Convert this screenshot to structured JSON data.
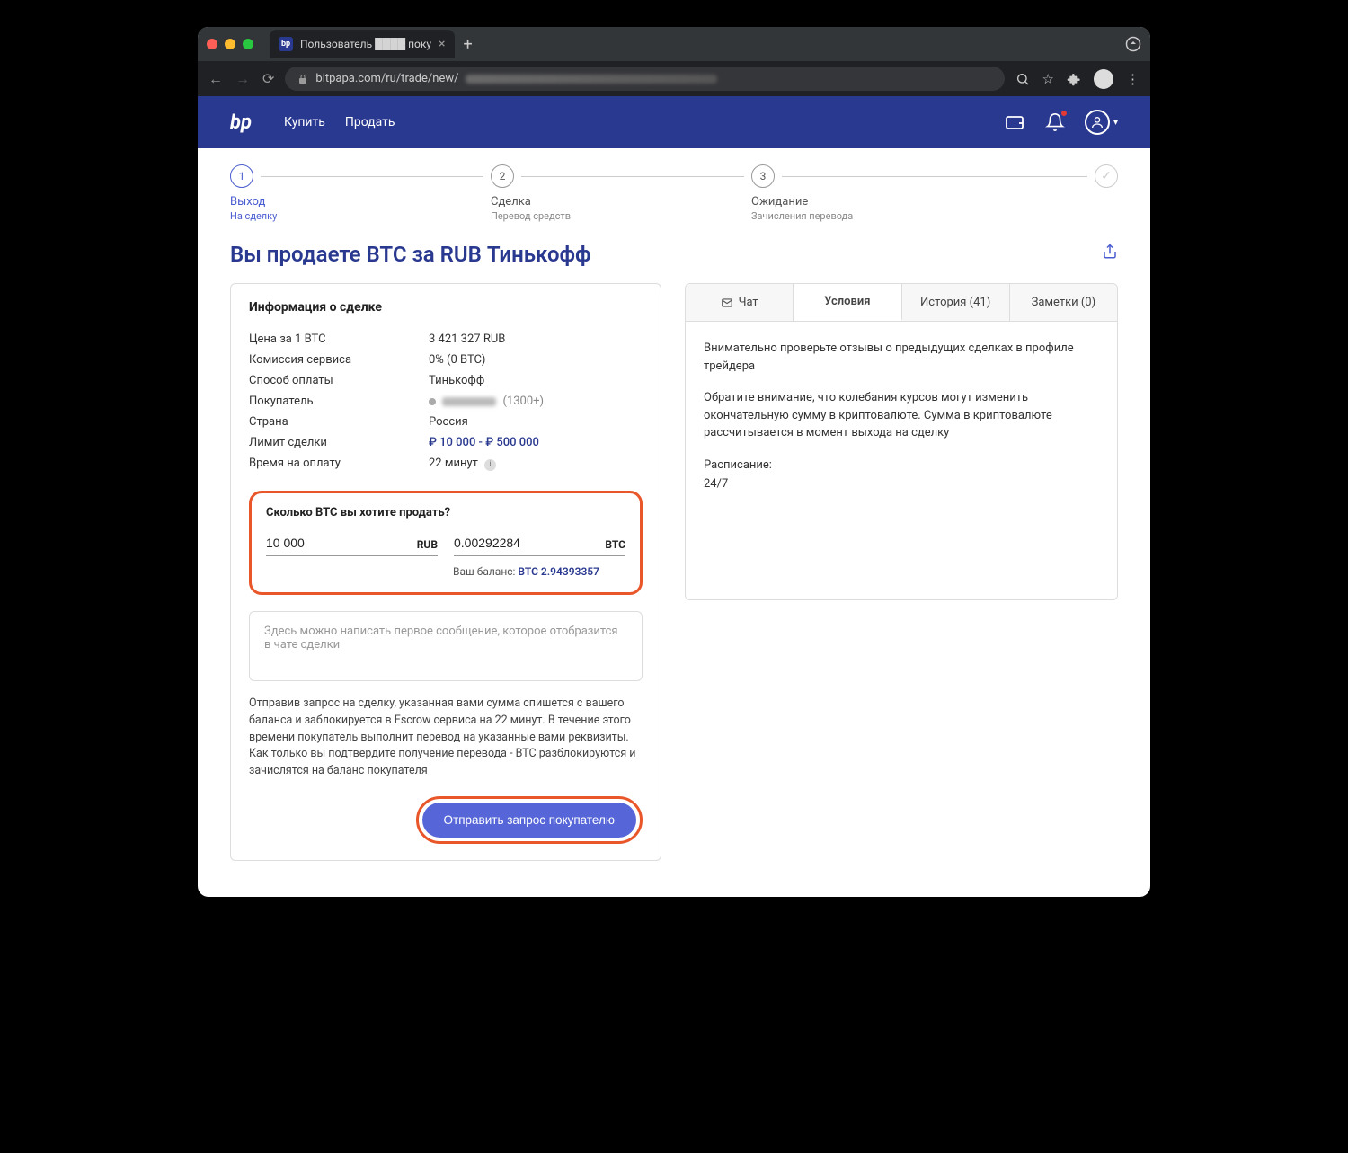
{
  "browser": {
    "tab_title": "Пользователь ████ поку",
    "url": "bitpapa.com/ru/trade/new/"
  },
  "header": {
    "nav_buy": "Купить",
    "nav_sell": "Продать"
  },
  "steps": {
    "s1_num": "1",
    "s1_label": "Выход",
    "s1_sub": "На сделку",
    "s2_num": "2",
    "s2_label": "Сделка",
    "s2_sub": "Перевод средств",
    "s3_num": "3",
    "s3_label": "Ожидание",
    "s3_sub": "Зачисления перевода"
  },
  "page": {
    "title": "Вы продаете BTC за RUB Тинькофф"
  },
  "deal": {
    "card_title": "Информация о сделке",
    "price_label": "Цена за 1 BTC",
    "price_value": "3 421 327 RUB",
    "fee_label": "Комиссия сервиса",
    "fee_value": "0% (0 BTC)",
    "method_label": "Способ оплаты",
    "method_value": "Тинькофф",
    "buyer_label": "Покупатель",
    "buyer_count": "(1300+)",
    "country_label": "Страна",
    "country_value": "Россия",
    "limit_label": "Лимит сделки",
    "limit_value": "₽ 10 000 - ₽ 500 000",
    "time_label": "Время на оплату",
    "time_value": "22 минут"
  },
  "sell": {
    "title": "Сколько BTC вы хотите продать?",
    "rub_value": "10 000",
    "rub_suffix": "RUB",
    "btc_value": "0.00292284",
    "btc_suffix": "BTC",
    "balance_text": "Ваш баланс: ",
    "balance_link": "BTC 2.94393357"
  },
  "message": {
    "placeholder": "Здесь можно написать первое сообщение, которое отобразится в чате сделки"
  },
  "disclaimer": "Отправив запрос на сделку, указанная вами сумма спишется с вашего баланса и заблокируется в Escrow сервиса на 22 минут. В течение этого времени покупатель выполнит перевод на указанные вами реквизиты. Как только вы подтвердите получение перевода - BTC разблокируются и зачислятся на баланс покупателя",
  "submit": "Отправить запрос покупателю",
  "tabs": {
    "chat": "Чат",
    "terms": "Условия",
    "history": "История (41)",
    "notes": "Заметки (0)"
  },
  "terms": {
    "p1": "Внимательно проверьте отзывы о предыдущих сделках в профиле трейдера",
    "p2": "Обратите внимание, что колебания курсов могут изменить окончательную сумму в криптовалюте. Сумма в криптовалюте рассчитывается в момент выхода на сделку",
    "p3": "Расписание:",
    "p4": "24/7"
  }
}
